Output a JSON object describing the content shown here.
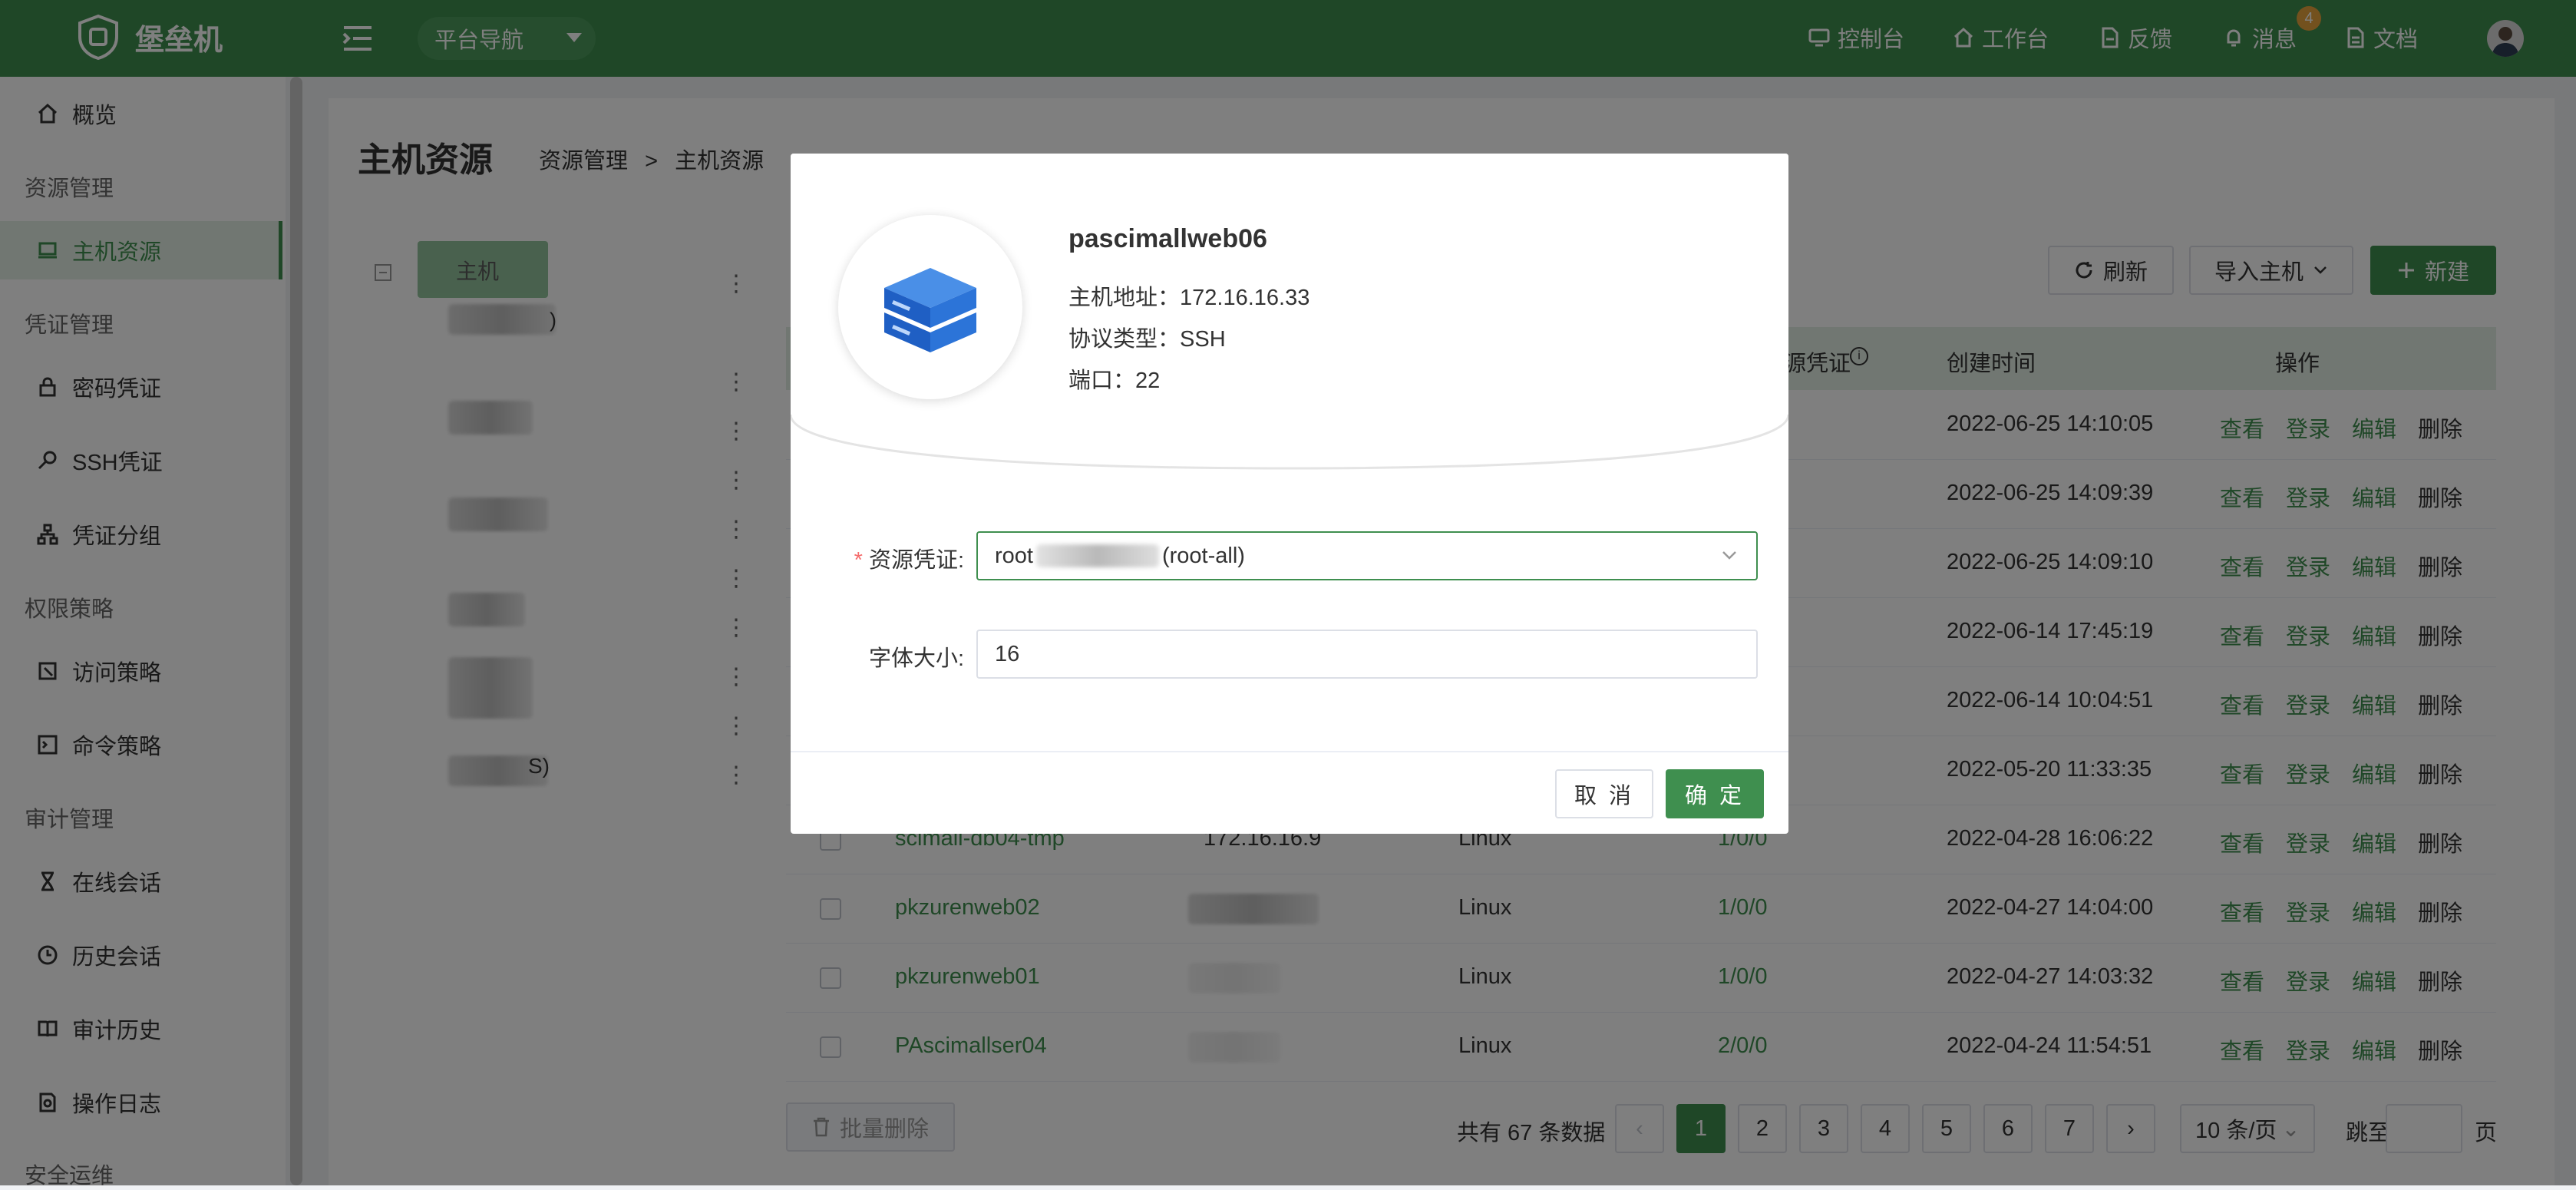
{
  "header": {
    "brand": "堡垒机",
    "nav_select": "平台导航",
    "items": [
      {
        "label": "控制台",
        "icon": "monitor-icon"
      },
      {
        "label": "工作台",
        "icon": "home-icon"
      },
      {
        "label": "反馈",
        "icon": "feedback-icon"
      },
      {
        "label": "消息",
        "icon": "bell-icon"
      },
      {
        "label": "文档",
        "icon": "document-icon"
      }
    ],
    "message_count": "4"
  },
  "sidebar": {
    "overview": "概览",
    "groups": {
      "resource": "资源管理",
      "credential": "凭证管理",
      "policy": "权限策略",
      "audit": "审计管理",
      "ops": "安全运维"
    },
    "items": {
      "host_resource": "主机资源",
      "password_cred": "密码凭证",
      "ssh_cred": "SSH凭证",
      "cred_group": "凭证分组",
      "access_policy": "访问策略",
      "command_policy": "命令策略",
      "online_session": "在线会话",
      "history_session": "历史会话",
      "audit_history": "审计历史",
      "operation_log": "操作日志"
    }
  },
  "page": {
    "title": "主机资源",
    "breadcrumb": [
      "资源管理",
      ">",
      "主机资源"
    ],
    "tree_root": "主机",
    "tree_tail_1": ")",
    "tree_tail_2": "S)"
  },
  "toolbar": {
    "refresh": "刷新",
    "import": "导入主机",
    "create": "新建"
  },
  "table": {
    "headers": {
      "credential": "源凭证",
      "created": "创建时间",
      "actions": "操作"
    },
    "actions": [
      "查看",
      "登录",
      "编辑",
      "删除"
    ],
    "rows": [
      {
        "name": "",
        "ip": "",
        "os": "",
        "cred": "",
        "created": "2022-06-25 14:10:05"
      },
      {
        "name": "",
        "ip": "",
        "os": "",
        "cred": "",
        "created": "2022-06-25 14:09:39"
      },
      {
        "name": "",
        "ip": "",
        "os": "",
        "cred": "",
        "created": "2022-06-25 14:09:10"
      },
      {
        "name": "",
        "ip": "",
        "os": "",
        "cred": "",
        "created": "2022-06-14 17:45:19"
      },
      {
        "name": "",
        "ip": "",
        "os": "",
        "cred": "",
        "created": "2022-06-14 10:04:51"
      },
      {
        "name": "",
        "ip": "",
        "os": "",
        "cred": "",
        "created": "2022-05-20 11:33:35"
      },
      {
        "name": "scimall-db04-tmp",
        "ip": "172.16.16.9",
        "os": "Linux",
        "cred": "1/0/0",
        "created": "2022-04-28 16:06:22"
      },
      {
        "name": "pkzurenweb02",
        "ip": "",
        "os": "Linux",
        "cred": "1/0/0",
        "created": "2022-04-27 14:04:00"
      },
      {
        "name": "pkzurenweb01",
        "ip": "",
        "os": "Linux",
        "cred": "1/0/0",
        "created": "2022-04-27 14:03:32"
      },
      {
        "name": "PAscimallser04",
        "ip": "",
        "os": "Linux",
        "cred": "2/0/0",
        "created": "2022-04-24 11:54:51"
      }
    ]
  },
  "footer": {
    "batch_delete": "批量删除",
    "total": "共有 67 条数据",
    "pages": [
      "1",
      "2",
      "3",
      "4",
      "5",
      "6",
      "7"
    ],
    "current_page": "1",
    "page_size": "10 条/页",
    "jump_label": "跳至",
    "page_unit": "页"
  },
  "modal": {
    "host_name": "pascimallweb06",
    "address_label": "主机地址：",
    "address": "172.16.16.33",
    "protocol_label": "协议类型：",
    "protocol": "SSH",
    "port_label": "端口：",
    "port": "22",
    "cred_label": "资源凭证:",
    "cred_prefix": "root",
    "cred_suffix": "(root-all)",
    "font_label": "字体大小:",
    "font_value": "16",
    "cancel": "取 消",
    "confirm": "确 定"
  },
  "colors": {
    "brand": "#3f8f4f",
    "badge": "#e6a23c"
  }
}
